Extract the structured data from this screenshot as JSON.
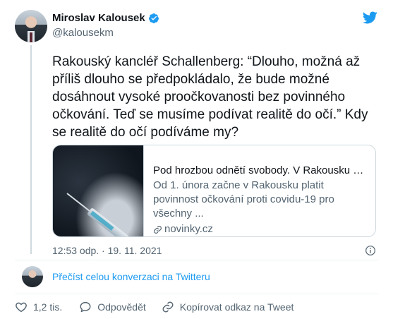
{
  "author": {
    "name": "Miroslav Kalousek",
    "handle": "@kalousekm"
  },
  "tweet": {
    "text": "Rakouský kancléř Schallenberg: “Dlouho, možná až příliš dlouho se předpokládalo, že bude možné dosáhnout vysoké proočkovanosti bez povinného očkování. Teď se musíme podívat realitě do očí.” Kdy se realitě do očí podíváme my?",
    "timestamp": "12:53 odp. · 19. 11. 2021"
  },
  "link_card": {
    "title": "Pod hrozbou odnětí svobody. V Rakousku bu...",
    "description": "Od 1. února začne v Rakousku platit povinnost očkování proti covidu-19 pro všechny ...",
    "domain": "novinky.cz"
  },
  "conversation_link": "Přečíst celou konverzaci na Twitteru",
  "actions": {
    "like_count": "1,2 tis.",
    "reply_label": "Odpovědět",
    "copy_label": "Kopírovat odkaz na Tweet"
  },
  "colors": {
    "accent": "#1d9bf0",
    "text": "#0f1419",
    "secondary": "#536471",
    "border": "#cfd9de"
  },
  "icons": [
    "verified-badge-icon",
    "twitter-bird-icon",
    "link-icon",
    "info-icon",
    "heart-icon",
    "reply-icon",
    "copy-link-icon"
  ]
}
